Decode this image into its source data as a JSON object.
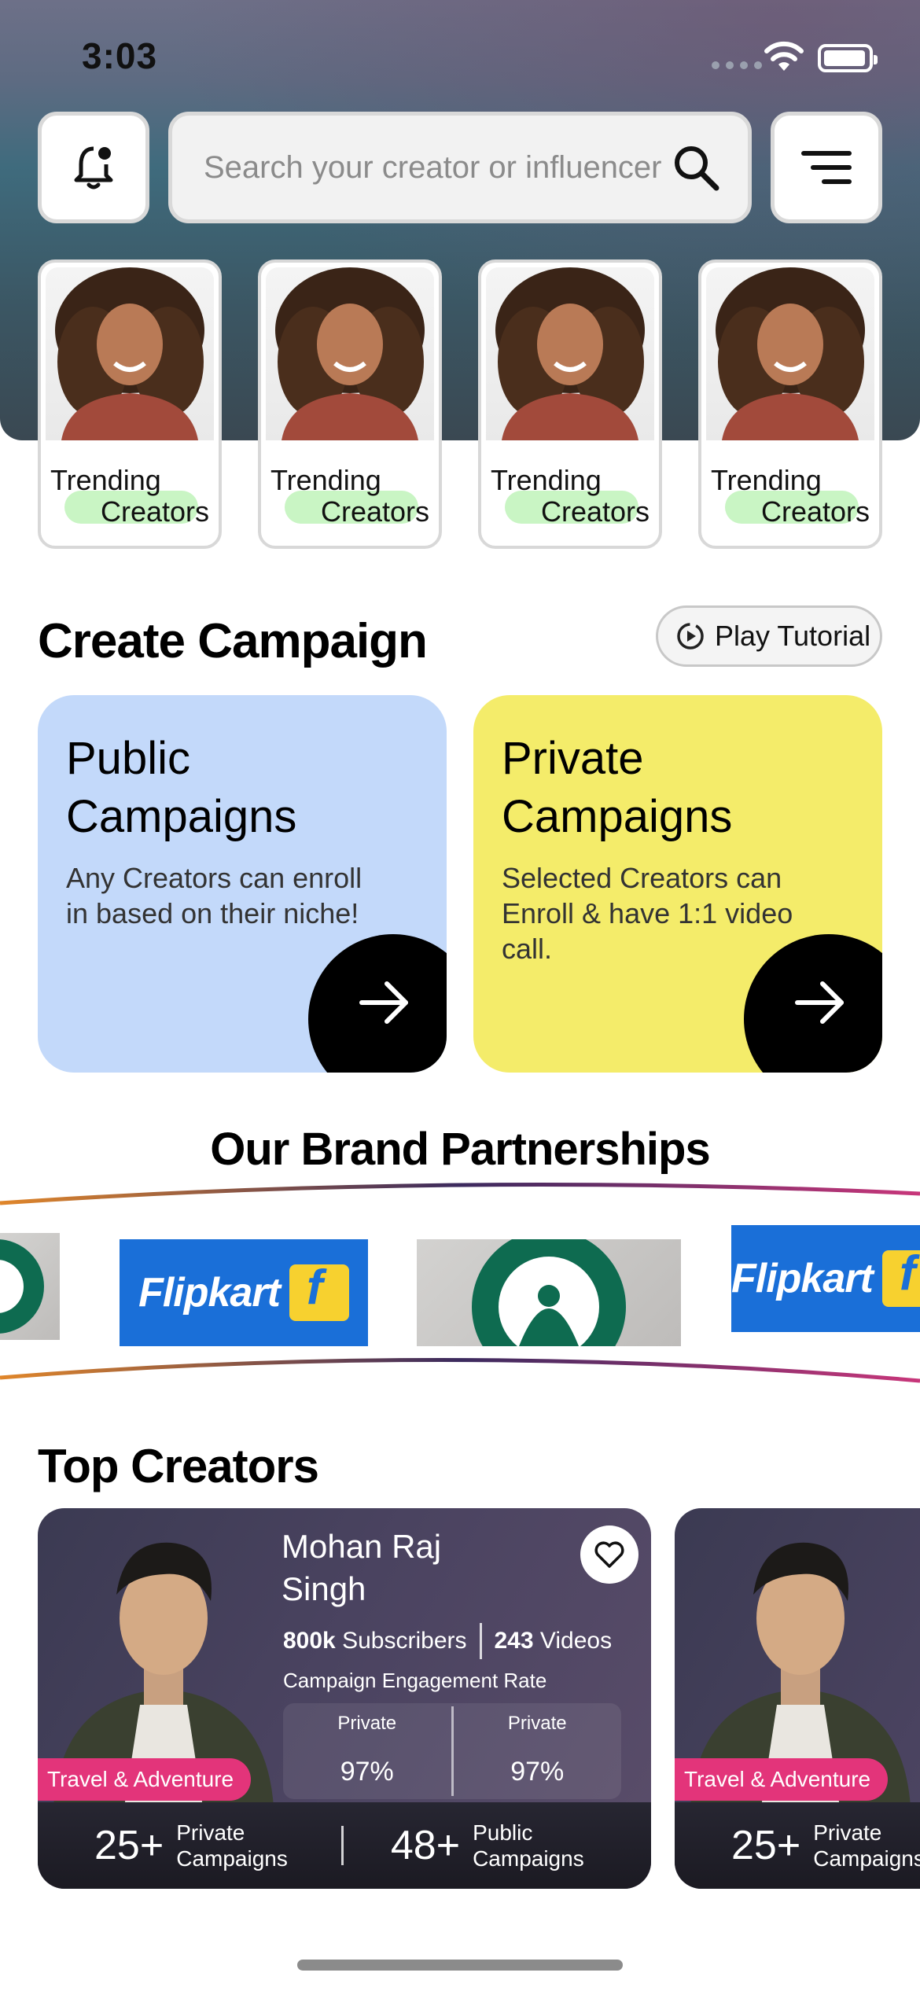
{
  "status_bar": {
    "time": "3:03"
  },
  "search": {
    "placeholder": "Search your creator or influencer"
  },
  "trending": [
    {
      "line1": "Trending",
      "line2": "Creators"
    },
    {
      "line1": "Trending",
      "line2": "Creators"
    },
    {
      "line1": "Trending",
      "line2": "Creators"
    },
    {
      "line1": "Trending",
      "line2": "Creators"
    }
  ],
  "create_campaign": {
    "title": "Create Campaign",
    "tutorial_label": "Play Tutorial",
    "public": {
      "title_line1": "Public",
      "title_line2": "Campaigns",
      "description": "Any Creators can enroll in based on their niche!"
    },
    "private": {
      "title_line1": "Private",
      "title_line2": "Campaigns",
      "description": "Selected Creators can Enroll & have 1:1 video call."
    }
  },
  "brands": {
    "title": "Our Brand Partnerships",
    "flipkart": "Flipkart"
  },
  "top_creators": {
    "title": "Top Creators",
    "cards": [
      {
        "name_line1": "Mohan Raj",
        "name_line2": "Singh",
        "subscribers_value": "800k",
        "subscribers_label": "Subscribers",
        "videos_value": "243",
        "videos_label": "Videos",
        "engagement_title": "Campaign Engagement Rate",
        "col1_label": "Private",
        "col1_value": "97%",
        "col2_label": "Private",
        "col2_value": "97%",
        "niche": "Travel & Adventure",
        "private_count": "25+",
        "private_label_1": "Private",
        "private_label_2": "Campaigns",
        "public_count": "48+",
        "public_label_1": "Public",
        "public_label_2": "Campaigns"
      },
      {
        "niche": "Travel & Adventure",
        "private_count": "25+",
        "private_label_1": "Private",
        "private_label_2": "Campaigns"
      }
    ]
  },
  "colors": {
    "public_card": "#c3d9fa",
    "private_card": "#f4ec6a",
    "niche_badge": "#e3347a",
    "trending_pill": "#c9f5c4"
  }
}
